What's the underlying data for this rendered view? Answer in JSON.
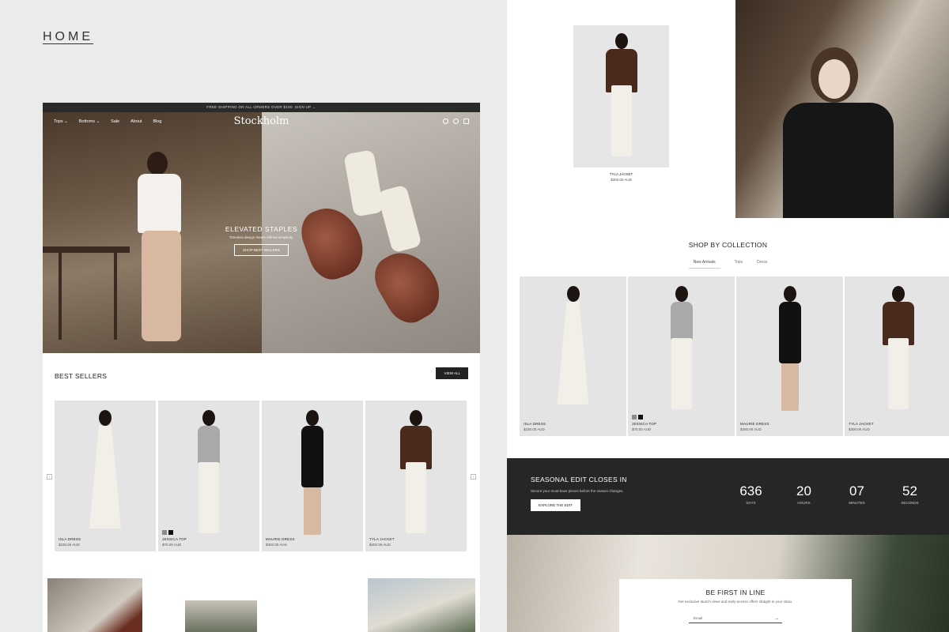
{
  "page_label": "HOME",
  "announcement": "FREE SHIPPING ON ALL ORDERS OVER $100. SIGN UP →",
  "nav": {
    "links": [
      "Tops ⌄",
      "Bottoms ⌄",
      "Sale",
      "About",
      "Blog"
    ],
    "logo": "Stockholm"
  },
  "hero": {
    "title": "ELEVATED STAPLES",
    "subtitle": "Timeless design meets refined simplicity.",
    "button": "SHOP BEST SELLERS"
  },
  "best_sellers": {
    "title": "BEST SELLERS",
    "view_all": "VIEW ALL",
    "products": [
      {
        "name": "ISLA DRESS",
        "price": "$230.00 AUD",
        "swatches": []
      },
      {
        "name": "JESSICA TOP",
        "price": "$70.00 AUD",
        "swatches": [
          "#8a8a8a",
          "#111111"
        ]
      },
      {
        "name": "MAURIE DRESS",
        "price": "$300.00 AUD",
        "swatches": []
      },
      {
        "name": "TYLA JACKET",
        "price": "$300.00 AUD",
        "swatches": []
      }
    ]
  },
  "featured": {
    "name": "TYLA JACKET",
    "price": "$300.00 AUD"
  },
  "collection": {
    "title": "SHOP BY COLLECTION",
    "tabs": [
      "New Arrivals",
      "Tops",
      "Dress"
    ],
    "products": [
      {
        "name": "ISLA DRESS",
        "price": "$230.00 AUD"
      },
      {
        "name": "JESSICA TOP",
        "price": "$70.00 AUD"
      },
      {
        "name": "MAURIE DRESS",
        "price": "$300.00 AUD"
      },
      {
        "name": "TYLA JACKET",
        "price": "$300.00 AUD"
      }
    ]
  },
  "countdown": {
    "title": "SEASONAL EDIT CLOSES IN",
    "subtitle": "Secure your must-have pieces before the season changes.",
    "button": "EXPLORE THE EDIT",
    "units": [
      {
        "value": "636",
        "label": "DAYS"
      },
      {
        "value": "20",
        "label": "HOURS"
      },
      {
        "value": "07",
        "label": "MINUTES"
      },
      {
        "value": "52",
        "label": "SECONDS"
      }
    ]
  },
  "signup": {
    "title": "BE FIRST IN LINE",
    "subtitle": "Get exclusive launch news and early-access offers straight to your inbox.",
    "placeholder": "Email",
    "arrow": "→"
  },
  "colors": {
    "dark": "#262626",
    "accent_brown": "#5a2c1e",
    "bg": "#ebebeb"
  }
}
